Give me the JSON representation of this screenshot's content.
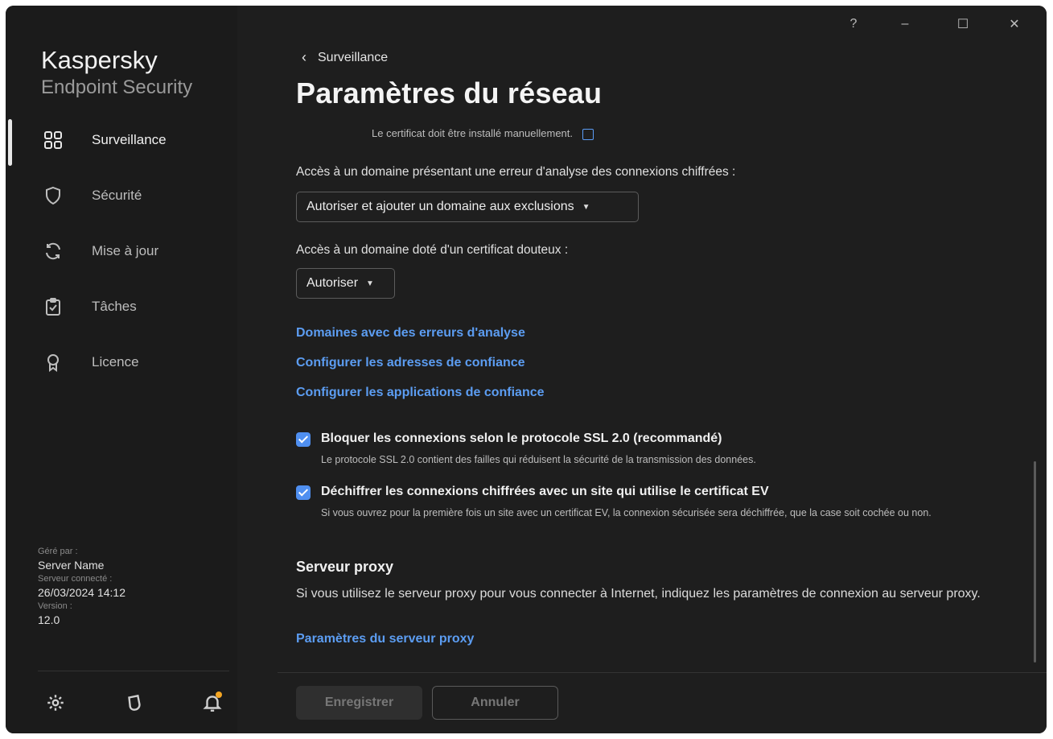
{
  "window": {
    "help_label": "?",
    "minimize_label": "–",
    "maximize_label": "☐",
    "close_label": "✕"
  },
  "brand": {
    "line1": "Kaspersky",
    "line2": "Endpoint Security"
  },
  "sidebar": {
    "items": [
      {
        "label": "Surveillance",
        "icon": "dashboard-grid-icon",
        "active": true
      },
      {
        "label": "Sécurité",
        "icon": "shield-icon",
        "active": false
      },
      {
        "label": "Mise à jour",
        "icon": "refresh-icon",
        "active": false
      },
      {
        "label": "Tâches",
        "icon": "clipboard-check-icon",
        "active": false
      },
      {
        "label": "Licence",
        "icon": "license-ribbon-icon",
        "active": false
      }
    ],
    "info": {
      "managed_by_label": "Géré par :",
      "managed_by_value": "Server Name",
      "server_connected_label": "Serveur connecté :",
      "server_connected_value": "26/03/2024 14:12",
      "version_label": "Version :",
      "version_value": "12.0"
    },
    "footer_icons": [
      "settings-gear-icon",
      "support-icon",
      "notifications-bell-icon"
    ]
  },
  "header": {
    "back_label": "Surveillance",
    "title": "Paramètres du réseau"
  },
  "content": {
    "cut_text": "Le certificat doit être installé manuellement.",
    "field1": {
      "label": "Accès à un domaine présentant une erreur d'analyse des connexions chiffrées :",
      "value": "Autoriser et ajouter un domaine aux exclusions"
    },
    "field2": {
      "label": "Accès à un domaine doté d'un certificat douteux :",
      "value": "Autoriser"
    },
    "links": [
      "Domaines avec des erreurs d'analyse",
      "Configurer les adresses de confiance",
      "Configurer les applications de confiance"
    ],
    "checkboxes": [
      {
        "title": "Bloquer les connexions selon le protocole SSL 2.0 (recommandé)",
        "desc": "Le protocole SSL 2.0 contient des failles qui réduisent la sécurité de la transmission des données.",
        "checked": true
      },
      {
        "title": "Déchiffrer les connexions chiffrées avec un site qui utilise le certificat EV",
        "desc": "Si vous ouvrez pour la première fois un site avec un certificat EV, la connexion sécurisée sera déchiffrée, que la case soit cochée ou non.",
        "checked": true
      }
    ],
    "proxy": {
      "title": "Serveur proxy",
      "text": "Si vous utilisez le serveur proxy pour vous connecter à Internet, indiquez les paramètres de connexion au serveur proxy.",
      "link": "Paramètres du serveur proxy"
    }
  },
  "footer": {
    "save_label": "Enregistrer",
    "cancel_label": "Annuler"
  },
  "colors": {
    "accent": "#5c9df2",
    "checkbox": "#4f8ff0",
    "notification_dot": "#f5a623",
    "background": "#1e1e1e"
  }
}
